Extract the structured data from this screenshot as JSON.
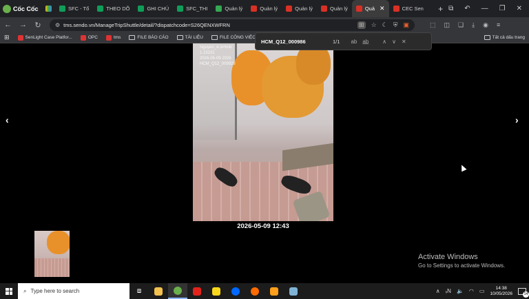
{
  "browser": {
    "brand": "Cốc Cốc",
    "tabs": [
      {
        "label": "SFC - Tổ",
        "fav_color": "#0f9d58"
      },
      {
        "label": "THEO DÕ",
        "fav_color": "#0f9d58"
      },
      {
        "label": "GHI CHÚ",
        "fav_color": "#0f9d58"
      },
      {
        "label": "SFC_THI",
        "fav_color": "#0f9d58"
      },
      {
        "label": "Quản lý",
        "fav_color": "#34a853"
      },
      {
        "label": "Quản lý",
        "fav_color": "#d93025"
      },
      {
        "label": "Quản lý",
        "fav_color": "#d93025"
      },
      {
        "label": "Quản lý",
        "fav_color": "#d93025"
      },
      {
        "label": "Quả",
        "fav_color": "#d93025",
        "active": true
      },
      {
        "label": "CEC Sen",
        "fav_color": "#d93025"
      }
    ],
    "url": "tms.sendo.vn/ManageTripShuttle/detail/?dispatchcode=S26QENXWFRN",
    "bookmarks": [
      {
        "label": "SenLight Case Platfor...",
        "type": "site"
      },
      {
        "label": "OPC",
        "type": "site"
      },
      {
        "label": "tms",
        "type": "site"
      },
      {
        "label": "FILE BÁO CÁO",
        "type": "folder"
      },
      {
        "label": "TÀI LIỆU",
        "type": "folder"
      },
      {
        "label": "FILE CÔNG VIỆC",
        "type": "folder"
      }
    ],
    "bookmarks_right": "Tất cả dấu trang"
  },
  "find_bar": {
    "query": "HCM_Q12_000986",
    "count": "1/1"
  },
  "viewer": {
    "caption": "2026-05-09 12:43",
    "overlay_lines": [
      "Nguyen_4.3P608",
      "1.15231",
      "2026-05-09 2026",
      "HCM_Q12_009928"
    ]
  },
  "watermark": {
    "title": "Activate Windows",
    "subtitle": "Go to Settings to activate Windows."
  },
  "taskbar": {
    "search_placeholder": "Type here to search",
    "time": "14:38",
    "date": "10/05/2026",
    "notifications": "14"
  },
  "colors": {
    "accent_orange": "#e8912a",
    "tab_bg": "#202124",
    "toolbar_bg": "#35363a"
  }
}
